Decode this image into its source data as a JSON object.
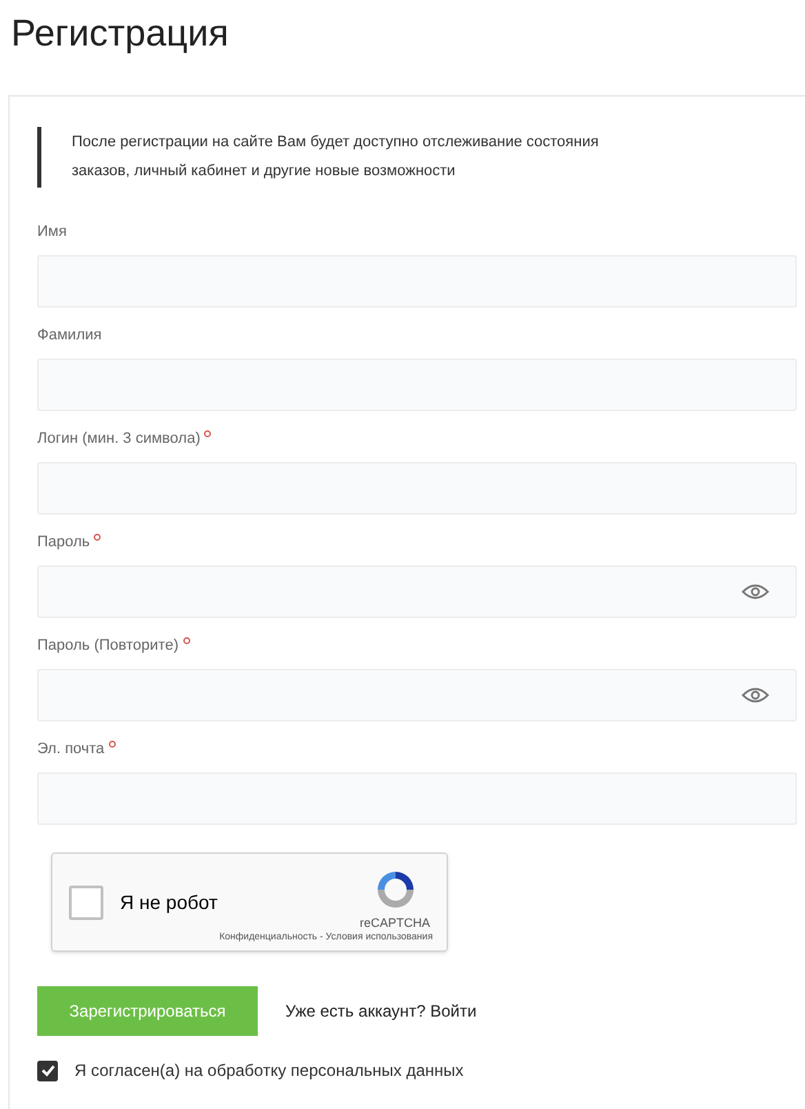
{
  "title": "Регистрация",
  "note": "После регистрации на сайте Вам будет доступно отслеживание состояния заказов, личный кабинет и другие новые возможности",
  "fields": [
    {
      "label": "Имя",
      "required": false,
      "kind": "text"
    },
    {
      "label": "Фамилия",
      "required": false,
      "kind": "text"
    },
    {
      "label": "Логин (мин. 3 символа)",
      "required": true,
      "kind": "text"
    },
    {
      "label": "Пароль",
      "required": true,
      "kind": "password"
    },
    {
      "label": "Пароль (Повторите)",
      "required": true,
      "kind": "password"
    },
    {
      "label": "Эл. почта",
      "required": true,
      "kind": "text"
    }
  ],
  "captcha": {
    "label": "Я не робот",
    "checked": false,
    "brand": "reCAPTCHA",
    "links": "Конфиденциальность - Условия использования"
  },
  "submit": "Зарегистрироваться",
  "login_link": "Уже есть аккаунт? Войти",
  "consent": {
    "label": "Я согласен(а) на обработку персональных данных",
    "checked": true
  }
}
